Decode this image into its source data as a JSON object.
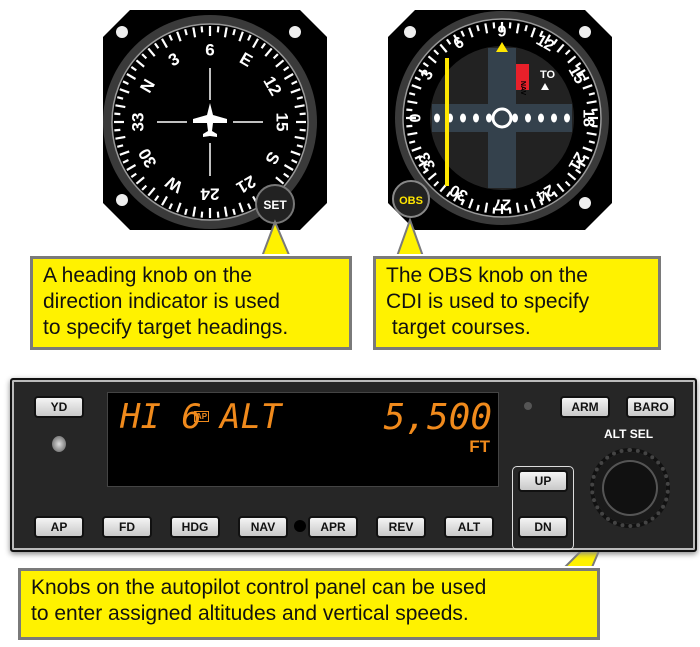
{
  "heading_indicator": {
    "card_labels": [
      "6",
      "E",
      "12",
      "15",
      "S",
      "21",
      "24",
      "W",
      "30",
      "33",
      "N",
      "3"
    ],
    "knob_label": "SET"
  },
  "cdi": {
    "card_labels": [
      "9",
      "12",
      "15",
      "18",
      "21",
      "24",
      "27",
      "30",
      "33",
      "0",
      "3",
      "6"
    ],
    "flag_label": "NAV",
    "to_from_label": "TO",
    "knob_label": "OBS",
    "needle_color": "#ffe600",
    "flag_color": "#e8202a"
  },
  "callouts": {
    "heading": [
      "A heading knob on the",
      "direction indicator is used",
      "to specify target headings."
    ],
    "obs": [
      "The OBS knob on the",
      "CDI is used to specify",
      " target courses."
    ],
    "autopilot": [
      "Knobs on the autopilot control panel can be used",
      "to enter assigned altitudes and vertical speeds."
    ]
  },
  "autopilot": {
    "display": {
      "mode_left": "HI 6",
      "ap_badge": "AP",
      "mode_right": "ALT",
      "altitude": "5,500",
      "unit": "FT"
    },
    "buttons": {
      "yd": "YD",
      "arm": "ARM",
      "baro": "BARO",
      "up": "UP",
      "dn": "DN",
      "ap": "AP",
      "fd": "FD",
      "hdg": "HDG",
      "nav": "NAV",
      "apr": "APR",
      "rev": "REV",
      "alt": "ALT"
    },
    "knob_label": "ALT SEL",
    "display_color": "#f08a1c",
    "callout_color": "#fff200"
  }
}
